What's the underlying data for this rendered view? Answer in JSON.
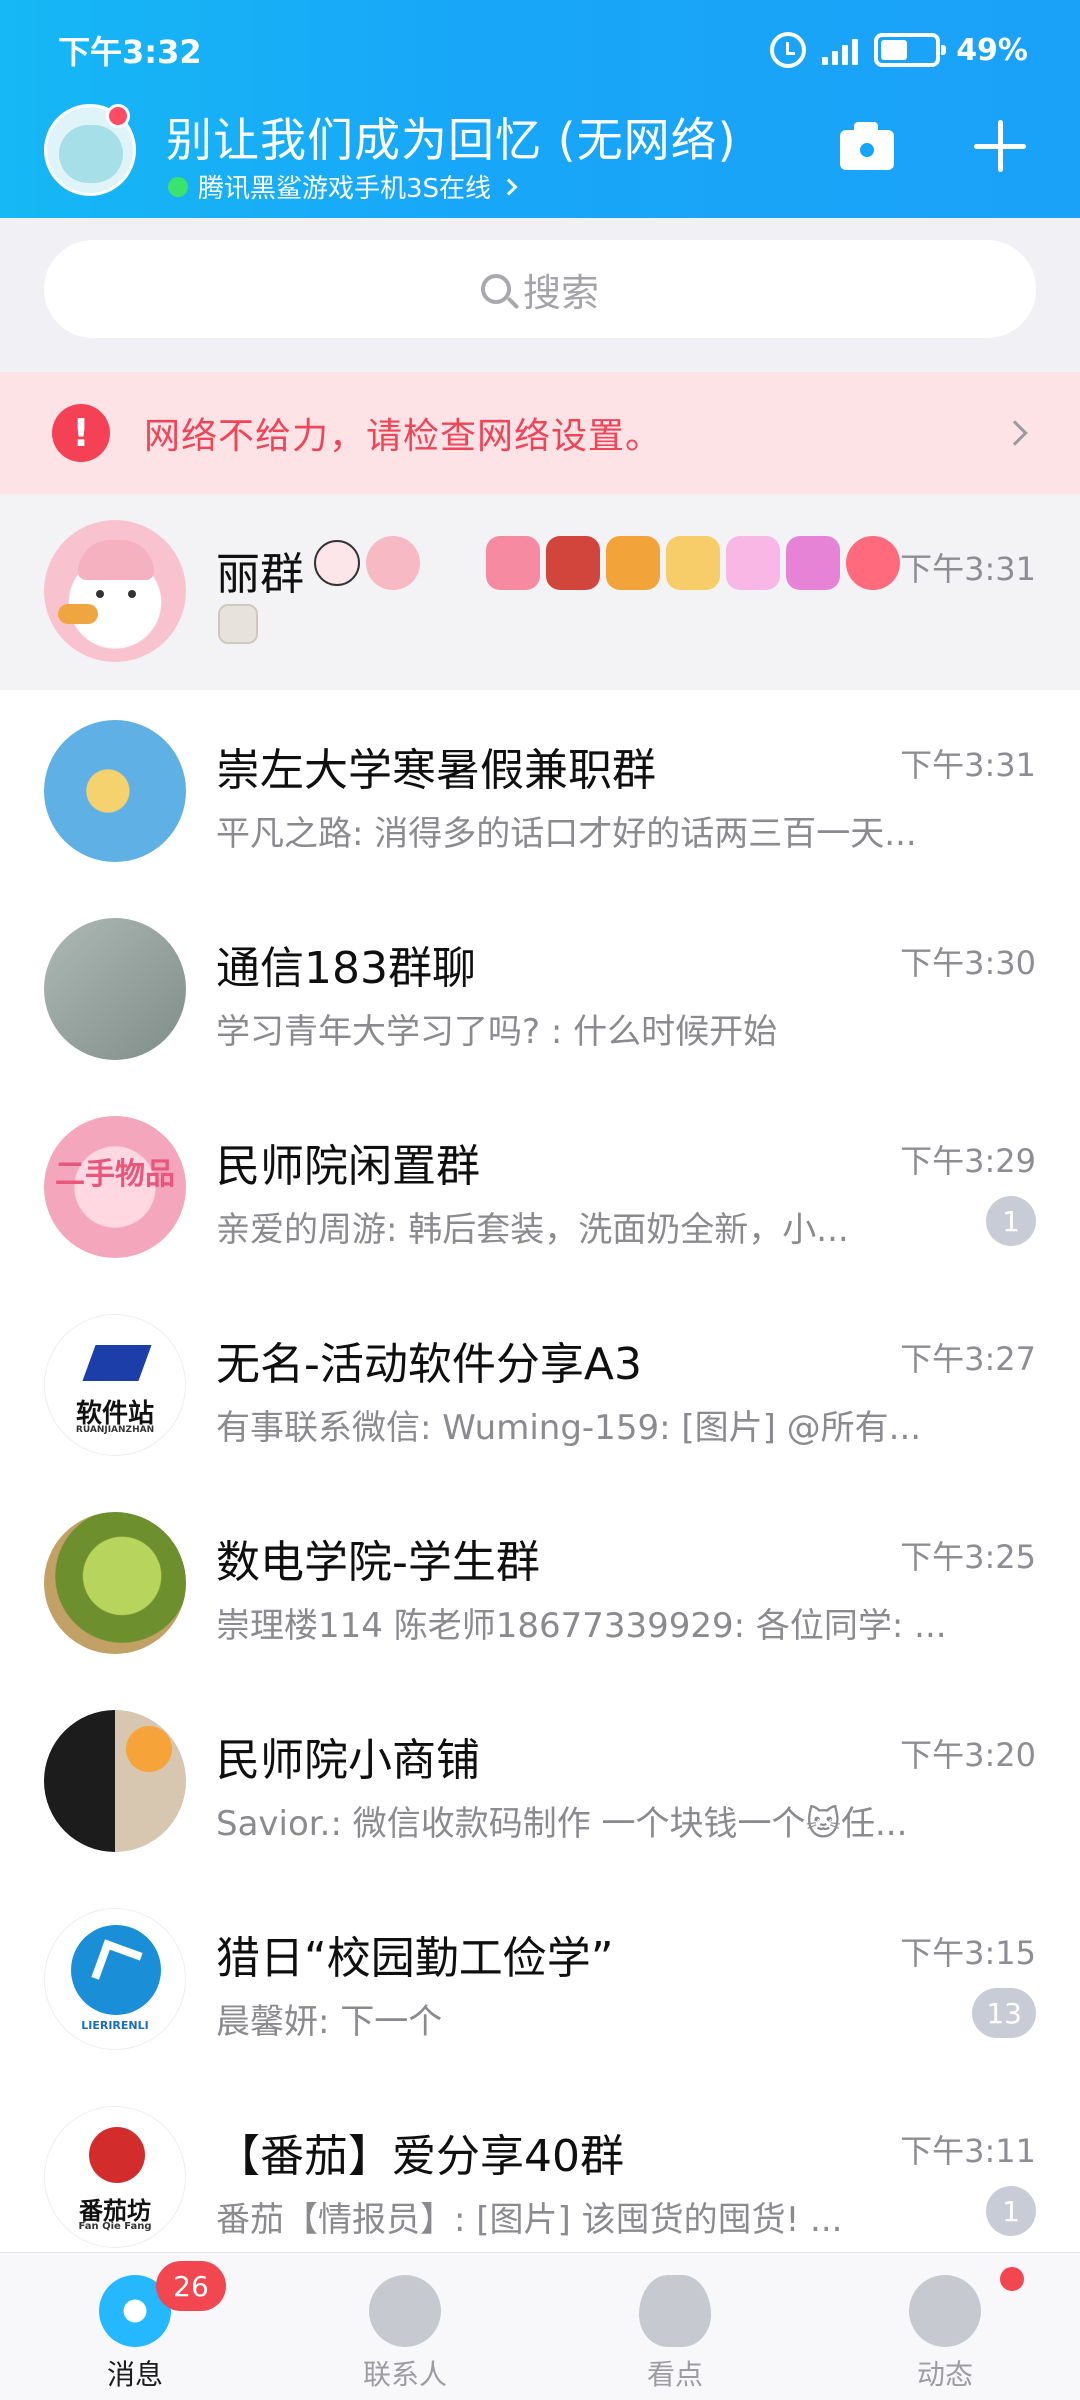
{
  "status_bar": {
    "time": "下午3:32",
    "battery": "49%"
  },
  "header": {
    "nickname": "别让我们成为回忆 (无网络)",
    "device_status": "腾讯黑鲨游戏手机3S在线"
  },
  "search": {
    "placeholder": "搜索"
  },
  "network_warning": {
    "text": "网络不给力，请检查网络设置。"
  },
  "chats": [
    {
      "name": "丽群",
      "time": "下午3:31",
      "preview": "",
      "badge": ""
    },
    {
      "name": "崇左大学寒暑假兼职群",
      "time": "下午3:31",
      "preview": "平凡之路: 消得多的话口才好的话两三百一天...",
      "badge": ""
    },
    {
      "name": "通信183群聊",
      "time": "下午3:30",
      "preview": "学习青年大学习了吗? : 什么时候开始",
      "badge": ""
    },
    {
      "name": "民师院闲置群",
      "time": "下午3:29",
      "preview": "亲爱的周游: 韩后套装，洗面奶全新，小...",
      "badge": "1"
    },
    {
      "name": "无名-活动软件分享A3",
      "time": "下午3:27",
      "preview": "有事联系微信: Wuming-159: [图片] @所有...",
      "badge": ""
    },
    {
      "name": "数电学院-学生群",
      "time": "下午3:25",
      "preview": "崇理楼114 陈老师18677339929: 各位同学: ...",
      "badge": ""
    },
    {
      "name": "民师院小商铺",
      "time": "下午3:20",
      "preview": "Savior.: 微信收款码制作 一个块钱一个🐱任...",
      "badge": ""
    },
    {
      "name": "猎日“校园勤工俭学”",
      "time": "下午3:15",
      "preview": "晨馨妍: 下一个",
      "badge": "13"
    },
    {
      "name": "【番茄】爱分享40群",
      "time": "下午3:11",
      "preview": "番茄【情报员】: [图片] 该囤货的囤货! ...",
      "badge": "1"
    }
  ],
  "avatars": {
    "secondhand_text": "二手物品",
    "software_text": "软件站",
    "software_sub": "RUANJIANZHAN",
    "lieri_text": "LIERIRENLI",
    "tomato_text": "番茄坊",
    "tomato_sub": "Fan Qie Fang"
  },
  "bottom_nav": {
    "messages": "消息",
    "contacts": "联系人",
    "look": "看点",
    "dynamic": "动态",
    "messages_badge": "26"
  },
  "colors": {
    "header_blue": "#18a6f8",
    "warning_red": "#f04559",
    "badge_gray": "#c8ccd6",
    "badge_red": "#f24750"
  }
}
